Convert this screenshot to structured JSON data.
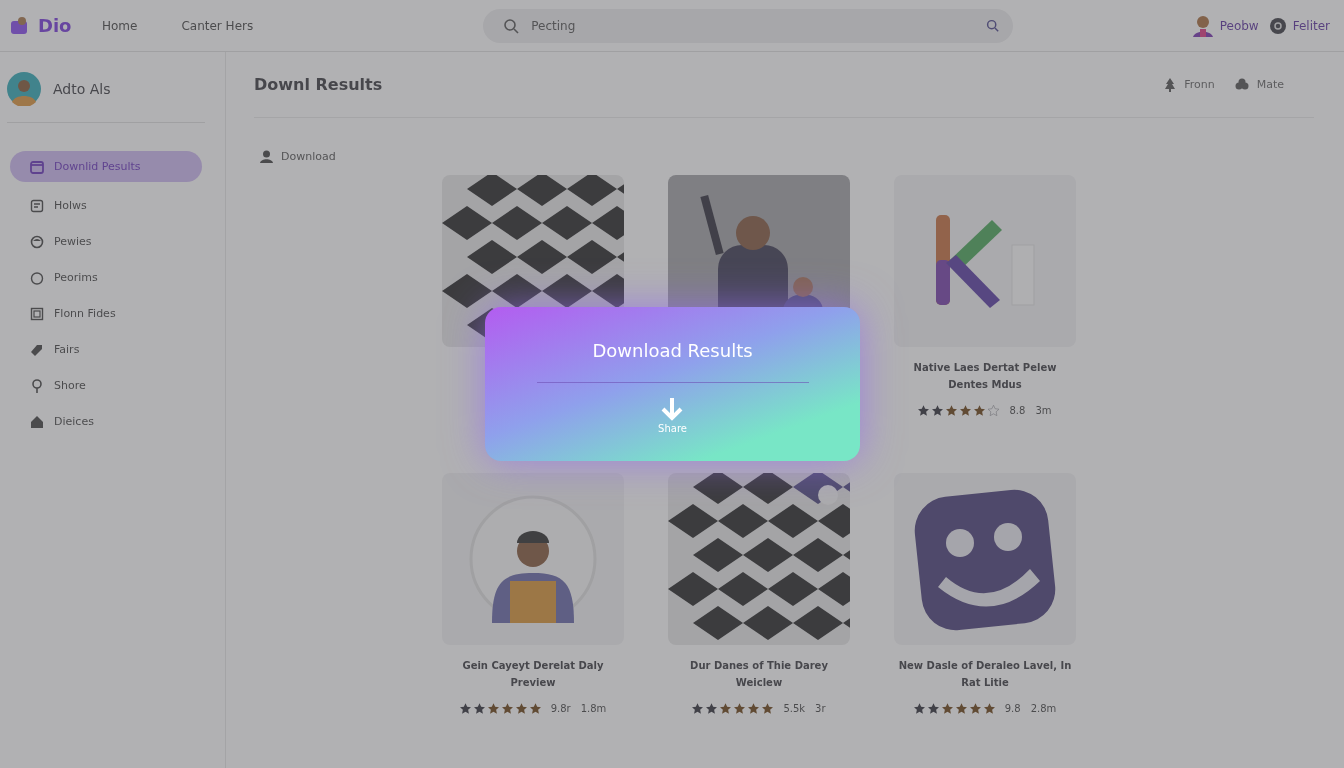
{
  "brand": {
    "name": "Dio"
  },
  "nav": [
    {
      "label": "Home"
    },
    {
      "label": "Canter Hers"
    }
  ],
  "search": {
    "placeholder": "Pecting"
  },
  "user_links": [
    {
      "label": "Peobw",
      "kind": "avatar"
    },
    {
      "label": "Feliter",
      "kind": "gear"
    }
  ],
  "profile": {
    "name": "Adto Als"
  },
  "sidebar": {
    "items": [
      {
        "label": "Downlid Pesults",
        "kind": "calendar",
        "selected": true
      },
      {
        "label": "Holws",
        "kind": "document",
        "selected": false
      },
      {
        "label": "Pewies",
        "kind": "smile",
        "selected": false
      },
      {
        "label": "Peorims",
        "kind": "circle",
        "selected": false
      },
      {
        "label": "Flonn Fides",
        "kind": "frame",
        "selected": false
      },
      {
        "label": "Fairs",
        "kind": "tag",
        "selected": false
      },
      {
        "label": "Shore",
        "kind": "pin",
        "selected": false
      },
      {
        "label": "Dieices",
        "kind": "home",
        "selected": false
      }
    ]
  },
  "page": {
    "title": "Downl Results",
    "actions": [
      {
        "label": "Fronn",
        "kind": "tree"
      },
      {
        "label": "Mate",
        "kind": "clover"
      }
    ],
    "link": "Download"
  },
  "cards": [
    {
      "kind": "picture"
    },
    {
      "kind": "picture"
    },
    {
      "kind": "picture",
      "title": "Native Laes Dertat Pelew Dentes Mdus",
      "stars": 5,
      "meta": [
        "8.8",
        "3m"
      ]
    },
    {
      "kind": "picture",
      "title": "Gein Cayeyt Derelat Daly Preview",
      "stars": 6,
      "meta": [
        "9.8r",
        "1.8m"
      ]
    },
    {
      "kind": "picture",
      "title": "Dur Danes of Thie Darey Weiclew",
      "stars": 6,
      "meta": [
        "5.5k",
        "3r"
      ]
    },
    {
      "kind": "picture",
      "title": "New Dasle of Deraleo Lavel, In Rat Litie",
      "stars": 6,
      "meta": [
        "9.8",
        "2.8m"
      ]
    }
  ],
  "modal": {
    "title": "Download Results",
    "action": "Share"
  }
}
